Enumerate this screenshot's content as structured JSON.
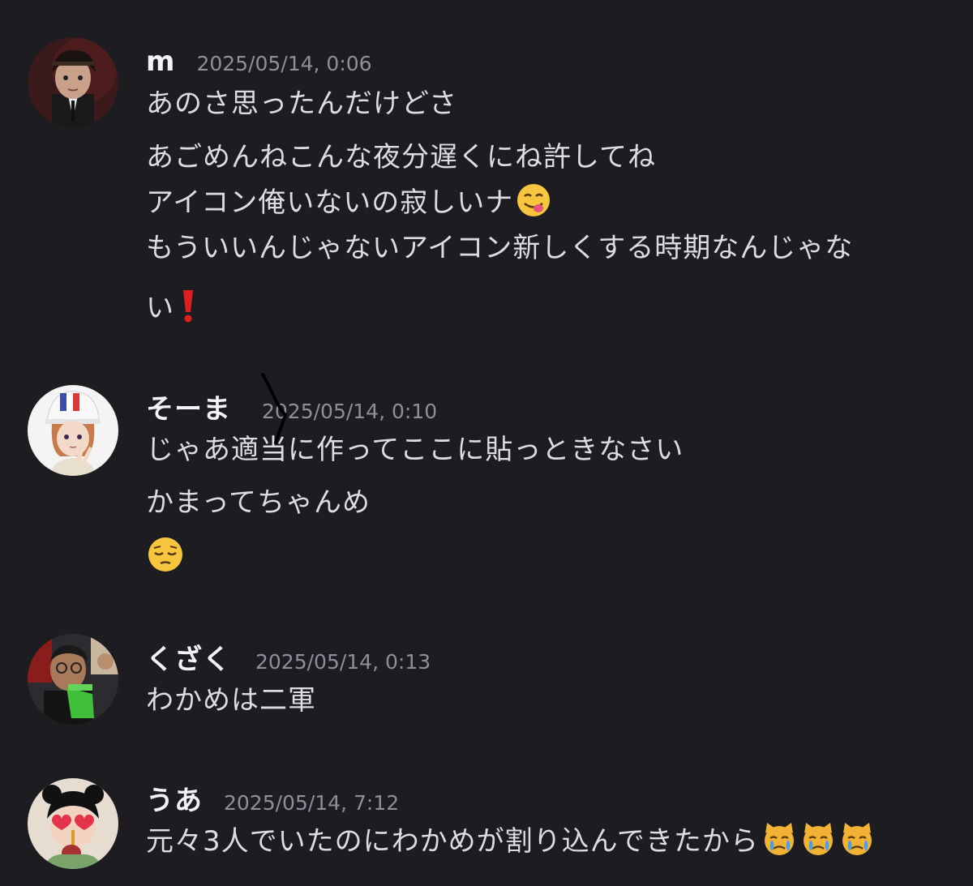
{
  "messages": [
    {
      "username": "m",
      "timestamp": "2025/05/14, 0:06",
      "avatar": "anime-dark-haired-character-avatar",
      "lines": [
        "あのさ思ったんだけどさ",
        "あごめんねこんな夜分遅くにね許してね",
        "アイコン俺いないの寂しいナ",
        "もういいんじゃないアイコン新しくする時期なんじゃな",
        "い"
      ],
      "emojis": [
        "face-savoring-food-emoji",
        "red-exclamation-emoji"
      ]
    },
    {
      "username": "そーま",
      "timestamp": "2025/05/14, 0:10",
      "avatar": "anime-character-white-cap-avatar",
      "lines": [
        "じゃあ適当に作ってここに貼っときなさい",
        "かまってちゃんめ"
      ],
      "emojis": [
        "pensive-face-emoji"
      ]
    },
    {
      "username": "くざく",
      "timestamp": "2025/05/14, 0:13",
      "avatar": "photo-man-glasses-avatar",
      "lines": [
        "わかめは二軍"
      ],
      "emojis": []
    },
    {
      "username": "うあ",
      "timestamp": "2025/05/14, 7:12",
      "avatar": "anime-girl-heart-glasses-avatar",
      "lines": [
        "元々3人でいたのにわかめが割り込んできたから"
      ],
      "emojis": [
        "crying-cat-emoji",
        "crying-cat-emoji",
        "crying-cat-emoji"
      ]
    }
  ],
  "colors": {
    "background": "#1c1c21",
    "username": "#f2f3f5",
    "timestamp": "#8e9099",
    "message_text": "#dcdde1"
  }
}
